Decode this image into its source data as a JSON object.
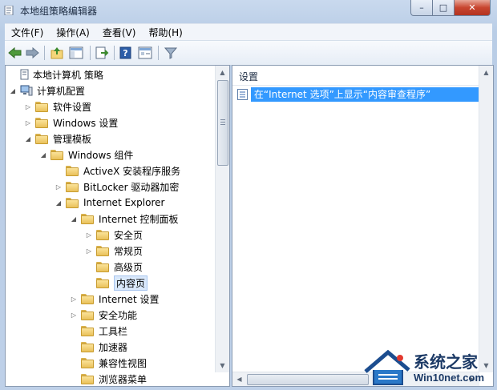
{
  "window": {
    "title": "本地组策略编辑器",
    "caption": {
      "minimize": "–",
      "maximize": "□",
      "close": "✕"
    }
  },
  "menu": [
    {
      "label": "文件(F)"
    },
    {
      "label": "操作(A)"
    },
    {
      "label": "查看(V)"
    },
    {
      "label": "帮助(H)"
    }
  ],
  "toolbar": {
    "icons": [
      "back-arrow-icon",
      "forward-arrow-icon",
      "up-folder-icon",
      "show-hide-tree-icon",
      "export-list-icon",
      "help-icon",
      "properties-icon",
      "filter-icon"
    ]
  },
  "tree": {
    "items": [
      {
        "label": "本地计算机 策略",
        "level": 0,
        "expander": "",
        "icon": "policy-doc-icon"
      },
      {
        "label": "计算机配置",
        "level": 0,
        "expander": "expanded",
        "icon": "computer-icon"
      },
      {
        "label": "软件设置",
        "level": 1,
        "expander": "collapsed",
        "icon": "folder-icon"
      },
      {
        "label": "Windows 设置",
        "level": 1,
        "expander": "collapsed",
        "icon": "folder-icon"
      },
      {
        "label": "管理模板",
        "level": 1,
        "expander": "expanded",
        "icon": "folder-icon"
      },
      {
        "label": "Windows 组件",
        "level": 2,
        "expander": "expanded",
        "icon": "folder-icon"
      },
      {
        "label": "ActiveX 安装程序服务",
        "level": 3,
        "expander": "",
        "icon": "folder-icon"
      },
      {
        "label": "BitLocker 驱动器加密",
        "level": 3,
        "expander": "collapsed",
        "icon": "folder-icon"
      },
      {
        "label": "Internet Explorer",
        "level": 3,
        "expander": "expanded",
        "icon": "folder-icon"
      },
      {
        "label": "Internet 控制面板",
        "level": 4,
        "expander": "expanded",
        "icon": "folder-icon"
      },
      {
        "label": "安全页",
        "level": 5,
        "expander": "collapsed",
        "icon": "folder-icon"
      },
      {
        "label": "常规页",
        "level": 5,
        "expander": "collapsed",
        "icon": "folder-icon"
      },
      {
        "label": "高级页",
        "level": 5,
        "expander": "",
        "icon": "folder-icon"
      },
      {
        "label": "内容页",
        "level": 5,
        "expander": "",
        "icon": "folder-open-icon",
        "selected": true
      },
      {
        "label": "Internet 设置",
        "level": 4,
        "expander": "collapsed",
        "icon": "folder-icon"
      },
      {
        "label": "安全功能",
        "level": 4,
        "expander": "collapsed",
        "icon": "folder-icon"
      },
      {
        "label": "工具栏",
        "level": 4,
        "expander": "",
        "icon": "folder-icon"
      },
      {
        "label": "加速器",
        "level": 4,
        "expander": "",
        "icon": "folder-icon"
      },
      {
        "label": "兼容性视图",
        "level": 4,
        "expander": "",
        "icon": "folder-icon"
      },
      {
        "label": "浏览器菜单",
        "level": 4,
        "expander": "",
        "icon": "folder-icon"
      }
    ]
  },
  "details": {
    "column_header": "设置",
    "rows": [
      {
        "label": "在“Internet 选项”上显示“内容审查程序”",
        "selected": true
      }
    ]
  },
  "watermark": {
    "line1": "系统之家",
    "line2": "Win10net.com"
  },
  "colors": {
    "selection": "#3399ff",
    "folder": "#f2cf6f"
  }
}
